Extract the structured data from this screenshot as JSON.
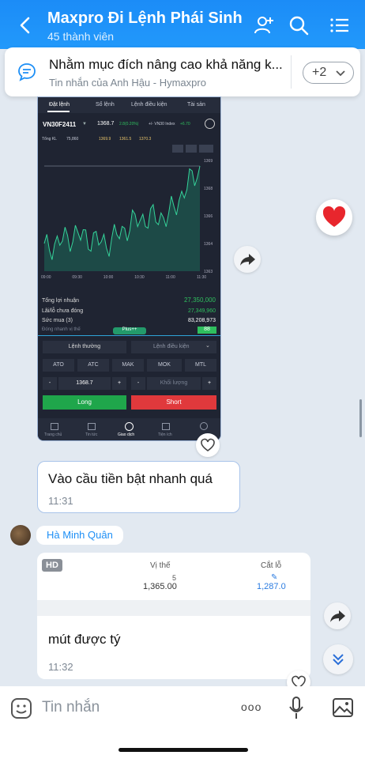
{
  "header": {
    "title": "Maxpro Đi Lệnh Phái Sinh",
    "subtitle": "45 thành viên"
  },
  "pinned": {
    "text": "Nhằm mục đích nâng cao khả năng k...",
    "source": "Tin nhắn của Anh Hậu - Hymaxpro",
    "more": "+2"
  },
  "shared_screenshot": {
    "tabs": [
      "Đặt lệnh",
      "Sổ lệnh",
      "Lệnh điều kiện",
      "Tài sản"
    ],
    "symbol": "VN30F2411",
    "price": "1368.7",
    "change": "2.8(0.20%)",
    "index_label": "+/- VN30 Index",
    "index_change": "+6.70",
    "tong_kl_label": "Tổng KL",
    "tong_kl": "75,860",
    "quotes": [
      "1369.9",
      "1361.5",
      "1370.3"
    ],
    "y_ticks": [
      "1369",
      "1368",
      "1366",
      "1364",
      "1363"
    ],
    "x_ticks": [
      "09:00",
      "09:30",
      "10:00",
      "10:30",
      "11:00",
      "11:30"
    ],
    "rows": [
      {
        "label": "Tổng lợi nhuận",
        "value": "27,350,000"
      },
      {
        "label": "Lãi/lỗ chưa đóng",
        "value": "27,349,960"
      },
      {
        "label": "Sức mua (3)",
        "value": "83,208,973"
      },
      {
        "label": "Đóng nhanh vị thế",
        "value": "88"
      }
    ],
    "plus_label": "Plus++",
    "order_type": "Lệnh thường",
    "cond_order": "Lệnh điều kiện",
    "order_buttons": [
      "ATO",
      "ATC",
      "MAK",
      "MOK",
      "MTL"
    ],
    "price_input": "1368.7",
    "qty_placeholder": "Khối lượng",
    "minus": "-",
    "plus": "+",
    "long_label": "Long",
    "short_label": "Short",
    "nav": [
      "Trang chủ",
      "Tin tức",
      "Giao dịch",
      "Tiện ích",
      ""
    ]
  },
  "message1": {
    "text": "Vào cầu tiền bật nhanh quá",
    "time": "11:31"
  },
  "sender2": "Hà Minh Quân",
  "card": {
    "badge": "HD",
    "col1": "Vị thế",
    "col2": "Cắt lỗ",
    "qty": "5",
    "position_price": "1,365.00",
    "stop_loss": "1,287.0",
    "text": "mút được tý",
    "time": "11:32"
  },
  "input": {
    "placeholder": "Tin nhắn"
  },
  "chart_data": {
    "type": "area",
    "x": [
      "09:00",
      "09:30",
      "10:00",
      "10:30",
      "11:00",
      "11:30"
    ],
    "series": [
      {
        "values": [
          1364.2,
          1365.0,
          1364.5,
          1365.8,
          1366.0,
          1368.7
        ]
      }
    ],
    "ylim": [
      1363,
      1369
    ],
    "grid": false
  },
  "colors": {
    "header": "#1b8cf7",
    "long": "#1fa64b",
    "short": "#e0393c",
    "link": "#1d8ff6"
  }
}
